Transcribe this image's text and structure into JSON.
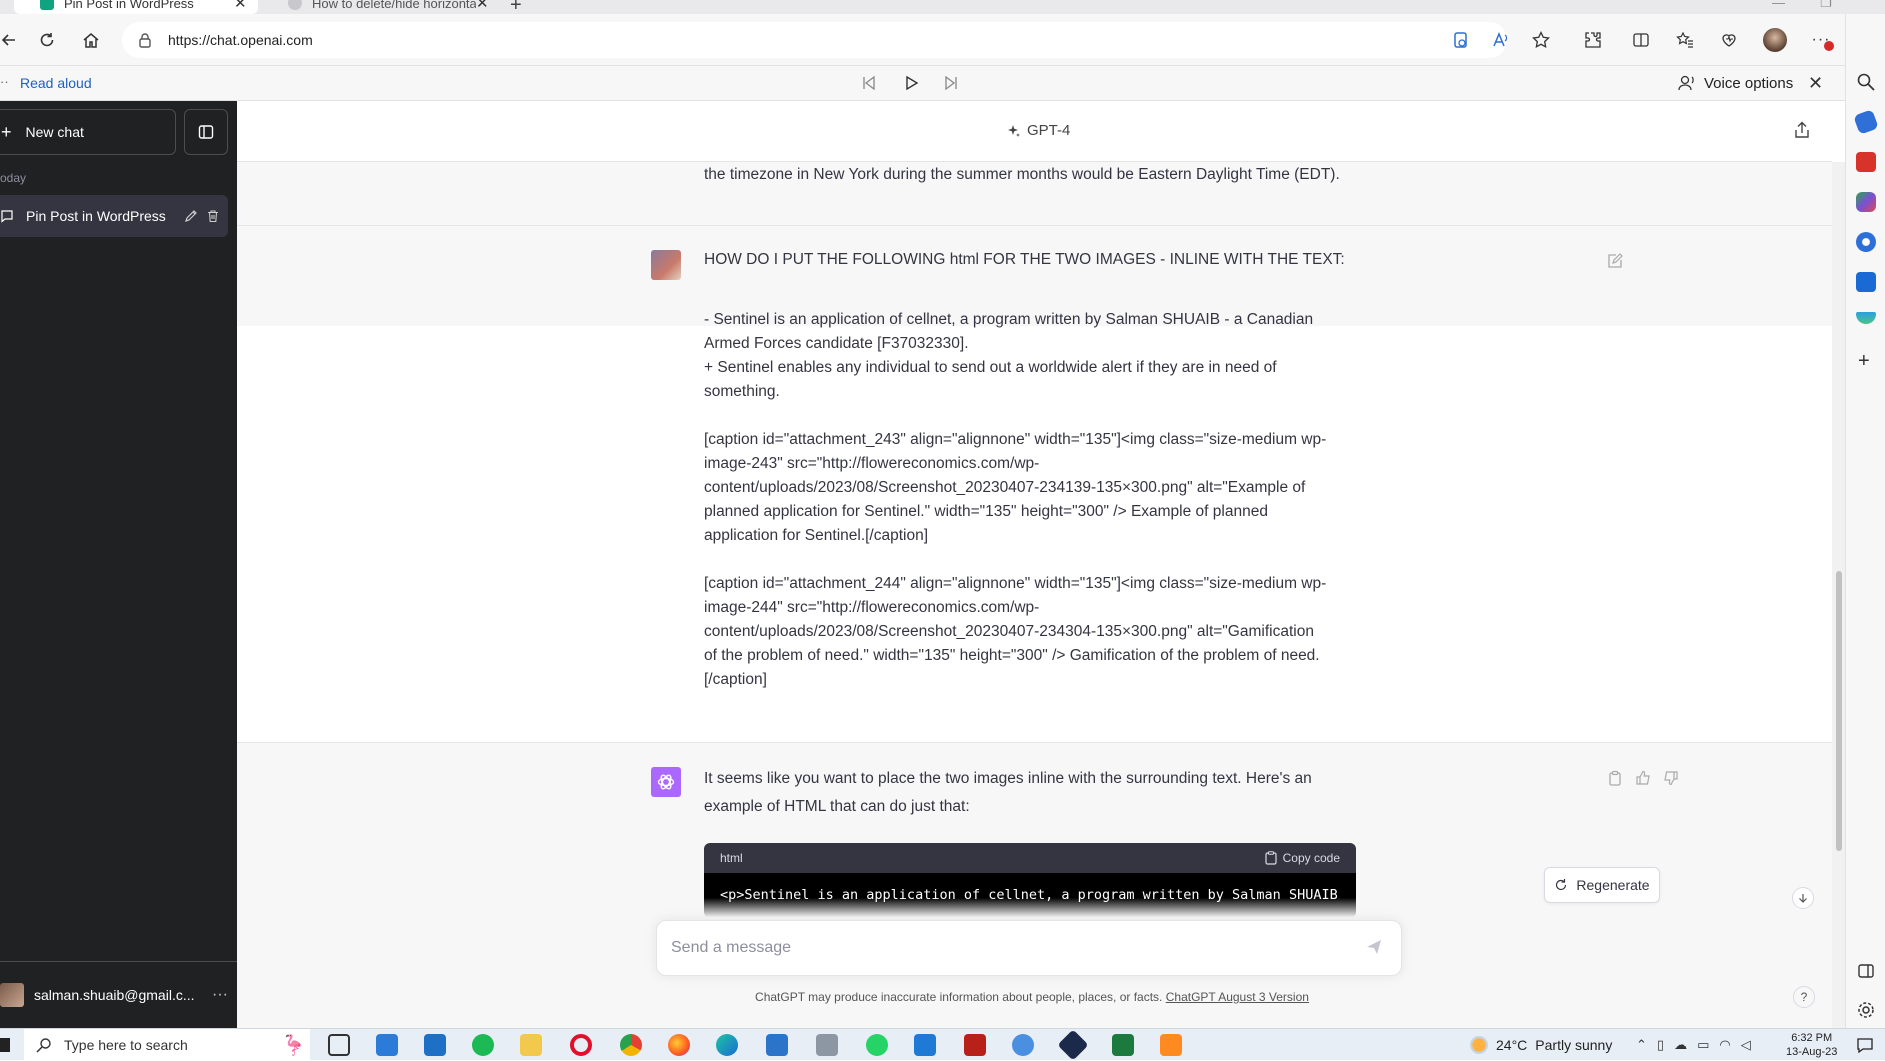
{
  "browser": {
    "tabs": [
      {
        "title": "Pin Post in WordPress",
        "active": true
      },
      {
        "title": "How to delete/hide horizontal li",
        "active": false
      }
    ],
    "url": "https://chat.openai.com",
    "read_aloud": {
      "label": "Read aloud",
      "voice_options": "Voice options"
    }
  },
  "sidebar": {
    "new_chat": "New chat",
    "section_label": "oday",
    "conversations": [
      {
        "title": "Pin Post in WordPress"
      }
    ],
    "user_email": "salman.shuaib@gmail.c..."
  },
  "header": {
    "model": "GPT-4"
  },
  "thread": {
    "previous_tail": "the timezone in New York during the summer months would be Eastern Daylight Time (EDT).",
    "user_message": {
      "heading": "HOW DO I PUT THE FOLLOWING html FOR THE TWO IMAGES - INLINE WITH THE TEXT:",
      "p1_line1": "- Sentinel is an application of cellnet, a program written by Salman SHUAIB - a Canadian",
      "p1_line2": "Armed Forces candidate [F37032330].",
      "p1_line3": "+ Sentinel enables any individual to send out a worldwide alert if they are in need of",
      "p1_line4": "something.",
      "p2_line1": "[caption id=\"attachment_243\" align=\"alignnone\" width=\"135\"]<img class=\"size-medium wp-",
      "p2_line2": "image-243\" src=\"http://flowereconomics.com/wp-",
      "p2_line3": "content/uploads/2023/08/Screenshot_20230407-234139-135×300.png\" alt=\"Example of",
      "p2_line4": "planned application for Sentinel.\" width=\"135\" height=\"300\" /> Example of planned",
      "p2_line5": "application for Sentinel.[/caption]",
      "p3_line1": "[caption id=\"attachment_244\" align=\"alignnone\" width=\"135\"]<img class=\"size-medium wp-",
      "p3_line2": "image-244\" src=\"http://flowereconomics.com/wp-",
      "p3_line3": "content/uploads/2023/08/Screenshot_20230407-234304-135×300.png\" alt=\"Gamification",
      "p3_line4": "of the problem of need.\" width=\"135\" height=\"300\" /> Gamification of the problem of need.",
      "p3_line5": "[/caption]"
    },
    "assistant_message": {
      "line1": "It seems like you want to place the two images inline with the surrounding text. Here's an",
      "line2": "example of HTML that can do just that:",
      "code_lang": "html",
      "copy_label": "Copy code",
      "code_line": "<p>Sentinel is an application of cellnet, a program written by Salman SHUAIB"
    }
  },
  "regenerate_label": "Regenerate",
  "composer": {
    "placeholder": "Send a message"
  },
  "disclaimer": {
    "text": "ChatGPT may produce inaccurate information about people, places, or facts.",
    "link": "ChatGPT August 3 Version"
  },
  "help_label": "?",
  "taskbar": {
    "search_placeholder": "Type here to search",
    "temperature": "24°C",
    "weather": "Partly sunny",
    "time": "6:32 PM",
    "date": "13-Aug-23"
  },
  "colors": {
    "sidebar_bg": "#202123",
    "selected_conv_bg": "#343541",
    "gpt_avatar": "#ab68ff",
    "read_aloud_link": "#1f5fbf"
  }
}
